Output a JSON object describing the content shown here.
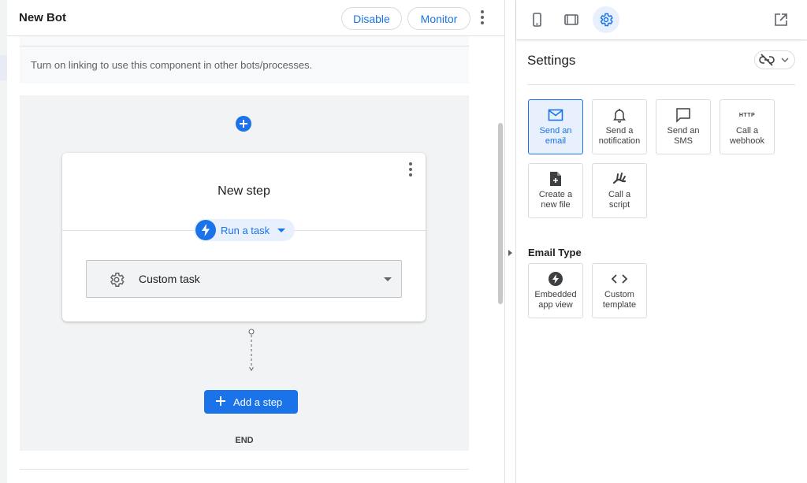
{
  "header": {
    "bot_title": "New Bot",
    "disable_label": "Disable",
    "monitor_label": "Monitor"
  },
  "linking": {
    "message": "Turn on linking to use this component in other bots/processes."
  },
  "step": {
    "title": "New step",
    "action_label": "Run a task",
    "task_select_value": "Custom task"
  },
  "flow": {
    "add_step_label": "Add a step",
    "end_label": "END"
  },
  "settings": {
    "title": "Settings",
    "task_tiles": [
      {
        "label": "Send an\nemail",
        "icon": "mail-icon",
        "selected": true
      },
      {
        "label": "Send a\nnotification",
        "icon": "bell-icon",
        "selected": false
      },
      {
        "label": "Send an\nSMS",
        "icon": "chat-bubble-icon",
        "selected": false
      },
      {
        "label": "Call a\nwebhook",
        "icon": "http-icon",
        "icon_text": "HTTP",
        "selected": false
      },
      {
        "label": "Create a\nnew file",
        "icon": "new-file-icon",
        "selected": false
      },
      {
        "label": "Call a\nscript",
        "icon": "script-icon",
        "selected": false
      }
    ],
    "email_type": {
      "label": "Email Type",
      "options": [
        {
          "label": "Embedded\napp view",
          "icon": "bolt-icon"
        },
        {
          "label": "Custom\ntemplate",
          "icon": "code-icon"
        }
      ]
    }
  },
  "colors": {
    "accent": "#1a73e8",
    "accent_light": "#e8f0fe",
    "canvas_bg": "#f1f3f4",
    "text_primary": "#202124",
    "text_secondary": "#5f6368"
  }
}
